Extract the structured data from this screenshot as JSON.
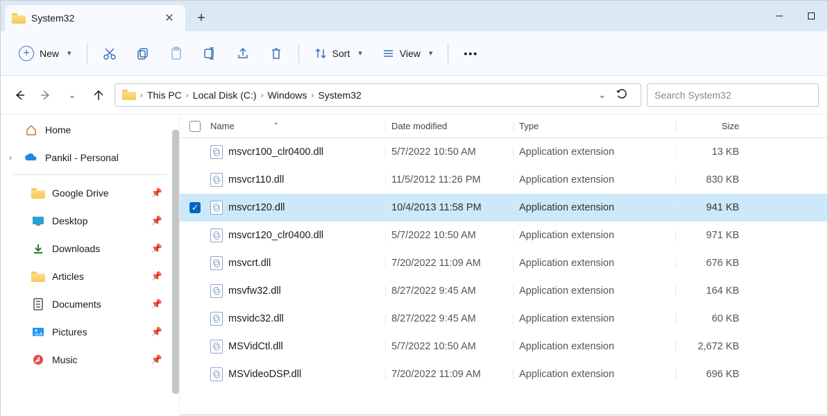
{
  "tab": {
    "title": "System32"
  },
  "toolbar": {
    "new_label": "New",
    "sort_label": "Sort",
    "view_label": "View"
  },
  "breadcrumb": {
    "items": [
      "This PC",
      "Local Disk (C:)",
      "Windows",
      "System32"
    ]
  },
  "search": {
    "placeholder": "Search System32"
  },
  "sidebar": {
    "home": "Home",
    "onedrive": "Pankil - Personal",
    "quick": [
      {
        "label": "Google Drive",
        "icon": "folder"
      },
      {
        "label": "Desktop",
        "icon": "desktop"
      },
      {
        "label": "Downloads",
        "icon": "download"
      },
      {
        "label": "Articles",
        "icon": "folder"
      },
      {
        "label": "Documents",
        "icon": "document"
      },
      {
        "label": "Pictures",
        "icon": "picture"
      },
      {
        "label": "Music",
        "icon": "music"
      }
    ]
  },
  "columns": {
    "name": "Name",
    "date": "Date modified",
    "type": "Type",
    "size": "Size"
  },
  "rows": [
    {
      "name": "msvcr100_clr0400.dll",
      "date": "5/7/2022 10:50 AM",
      "type": "Application extension",
      "size": "13 KB",
      "selected": false
    },
    {
      "name": "msvcr110.dll",
      "date": "11/5/2012 11:26 PM",
      "type": "Application extension",
      "size": "830 KB",
      "selected": false
    },
    {
      "name": "msvcr120.dll",
      "date": "10/4/2013 11:58 PM",
      "type": "Application extension",
      "size": "941 KB",
      "selected": true
    },
    {
      "name": "msvcr120_clr0400.dll",
      "date": "5/7/2022 10:50 AM",
      "type": "Application extension",
      "size": "971 KB",
      "selected": false
    },
    {
      "name": "msvcrt.dll",
      "date": "7/20/2022 11:09 AM",
      "type": "Application extension",
      "size": "676 KB",
      "selected": false
    },
    {
      "name": "msvfw32.dll",
      "date": "8/27/2022 9:45 AM",
      "type": "Application extension",
      "size": "164 KB",
      "selected": false
    },
    {
      "name": "msvidc32.dll",
      "date": "8/27/2022 9:45 AM",
      "type": "Application extension",
      "size": "60 KB",
      "selected": false
    },
    {
      "name": "MSVidCtl.dll",
      "date": "5/7/2022 10:50 AM",
      "type": "Application extension",
      "size": "2,672 KB",
      "selected": false
    },
    {
      "name": "MSVideoDSP.dll",
      "date": "7/20/2022 11:09 AM",
      "type": "Application extension",
      "size": "696 KB",
      "selected": false
    }
  ]
}
